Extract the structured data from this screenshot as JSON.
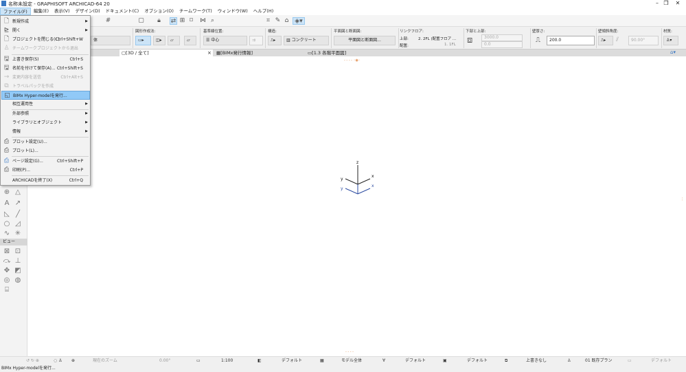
{
  "window": {
    "title": "名称未設定 - GRAPHISOFT ARCHICAD-64 20",
    "minimize": "–",
    "restore": "❐",
    "close": "✕"
  },
  "menubar": [
    "ファイル(F)",
    "編集(E)",
    "表示(V)",
    "デザイン(D)",
    "ドキュメント(C)",
    "オプション(O)",
    "チームワーク(T)",
    "ウィンドウ(W)",
    "ヘルプ(H)"
  ],
  "file_menu": [
    {
      "label": "新規作成",
      "icon": "new-file-icon",
      "submenu": true
    },
    {
      "label": "開く",
      "icon": "open-folder-icon",
      "submenu": true
    },
    {
      "label": "プロジェクトを閉じる(C)",
      "shortcut": "Ctrl+Shift+W",
      "icon": "close-project-icon"
    },
    {
      "label": "チームワークプロジェクトから退出",
      "icon": "teamwork-leave-icon",
      "disabled": true
    },
    {
      "label": "上書き保存(S)",
      "shortcut": "Ctrl+S",
      "icon": "save-icon"
    },
    {
      "label": "名前を付けて保存(A)...",
      "shortcut": "Ctrl+Shift+S",
      "icon": "save-as-icon"
    },
    {
      "label": "変更内容を送信",
      "shortcut": "Ctrl+Alt+S",
      "icon": "send-changes-icon",
      "disabled": true
    },
    {
      "label": "トラベルパックを作成",
      "icon": "travel-pack-icon",
      "disabled": true
    },
    {
      "label": "BIMx Hyper-modelを発行...",
      "icon": "bimx-icon",
      "highlighted": true
    },
    {
      "label": "相互運用性",
      "submenu": true
    },
    {
      "label": "外部参照",
      "submenu": true
    },
    {
      "label": "ライブラリとオブジェクト",
      "submenu": true
    },
    {
      "label": "情報",
      "submenu": true
    },
    {
      "label": "プロット設定(U)...",
      "icon": "plot-setup-icon"
    },
    {
      "label": "プロット(L)...",
      "icon": "plotter-icon"
    },
    {
      "label": "ページ設定(G)...",
      "shortcut": "Ctrl+Shift+P",
      "icon": "page-setup-icon"
    },
    {
      "label": "印刷(P)...",
      "shortcut": "Ctrl+P",
      "icon": "print-icon"
    },
    {
      "label": "ARCHICADを終了(X)",
      "shortcut": "Ctrl+Q"
    }
  ],
  "infobox": {
    "geometry_label": "図形作成法:",
    "reference_label": "基準線位置:",
    "reference_value": "中心",
    "structure_label": "構造:",
    "structure_value": "コンクリート",
    "plan_section_label": "平面図と断面図:",
    "plan_section_value": "平面図と断面図...",
    "link_floor_label": "リンクフロア:",
    "top_label": "上部:",
    "top_value": "2. 2FL (配置フロア ...",
    "home_label": "配置:",
    "home_value": "1. 1FL",
    "bottom_top_label": "下部と上部:",
    "height_value": "3000.0",
    "offset_value": "0.0",
    "thickness_label": "壁厚さ:",
    "thickness_value": "200.0",
    "slant_label": "壁傾斜角度:",
    "slant_value": "90.00°",
    "material_label": "材質:",
    "left_partial": "体"
  },
  "tabs": [
    {
      "label": "[3D / 全て]",
      "active": true
    },
    {
      "label": "[BIMx発行情報]"
    },
    {
      "label": "[1.3 各階平面図]"
    }
  ],
  "tab_close": "×",
  "toolbox": {
    "view_section": "ビュー"
  },
  "axes": {
    "z": "z",
    "x": "x",
    "y": "y"
  },
  "statusbar": {
    "zoom": "現在のズーム",
    "angle": "0.00°",
    "scale": "1:100",
    "layer": "デフォルト",
    "model": "モデル全体",
    "pen": "デフォルト",
    "mvo": "デフォルト",
    "override": "上書きなし",
    "renovation": "01 既存プラン",
    "last": "デフォルト"
  },
  "status_text": "BIMx Hyper-modelを発行..."
}
